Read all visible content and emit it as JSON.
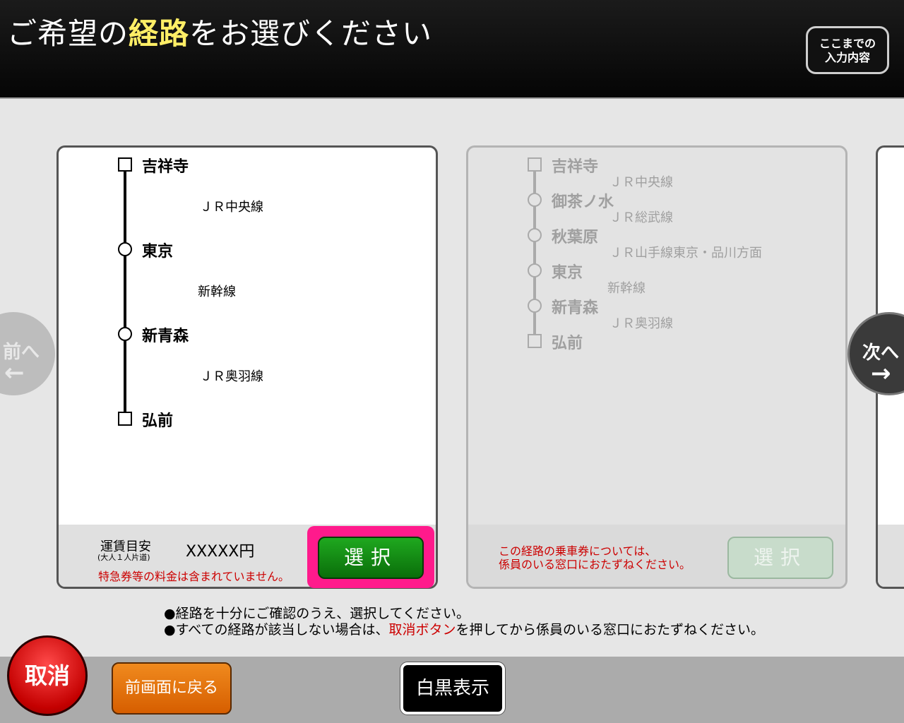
{
  "header": {
    "title_pre": "ご希望の",
    "title_highlight": "経路",
    "title_post": "をお選びください",
    "review_button_line1": "ここまでの",
    "review_button_line2": "入力内容"
  },
  "routes": [
    {
      "stations": [
        {
          "name": "吉祥寺",
          "node": "square"
        },
        {
          "name": "東京",
          "node": "circle"
        },
        {
          "name": "新青森",
          "node": "circle"
        },
        {
          "name": "弘前",
          "node": "square"
        }
      ],
      "lines": [
        "ＪＲ中央線",
        "新幹線",
        "ＪＲ奥羽線"
      ],
      "fare_label": "運賃目安",
      "fare_sublabel": "(大人１人片道)",
      "fare_value": "XXXXX円",
      "fare_note": "特急券等の料金は含まれていません。",
      "select_label": "選択",
      "enabled": true
    },
    {
      "stations": [
        {
          "name": "吉祥寺",
          "node": "square"
        },
        {
          "name": "御茶ノ水",
          "node": "circle"
        },
        {
          "name": "秋葉原",
          "node": "circle"
        },
        {
          "name": "東京",
          "node": "circle"
        },
        {
          "name": "新青森",
          "node": "circle"
        },
        {
          "name": "弘前",
          "node": "square"
        }
      ],
      "lines": [
        "ＪＲ中央線",
        "ＪＲ総武線",
        "ＪＲ山手線東京・品川方面",
        "新幹線",
        "ＪＲ奥羽線"
      ],
      "note_line1": "この経路の乗車券については、",
      "note_line2": "係員のいる窓口におたずねください。",
      "select_label": "選択",
      "enabled": false
    }
  ],
  "nav": {
    "prev_label": "前へ",
    "prev_arrow": "←",
    "next_label": "次へ",
    "next_arrow": "→"
  },
  "instructions": {
    "line1": "●経路を十分にご確認のうえ、選択してください。",
    "line2_pre": "●すべての経路が該当しない場合は、",
    "line2_red": "取消ボタン",
    "line2_post": "を押してから係員のいる窓口におたずねください。"
  },
  "bottom": {
    "cancel_label": "取消",
    "back_label": "前画面に戻る",
    "mono_label": "白黒表示"
  },
  "colors": {
    "highlight_yellow": "#ffee66",
    "select_green": "#108a10",
    "selected_frame": "#ff1a8c",
    "cancel_red": "#d40000",
    "back_orange": "#e87412",
    "note_red": "#cc0000"
  }
}
